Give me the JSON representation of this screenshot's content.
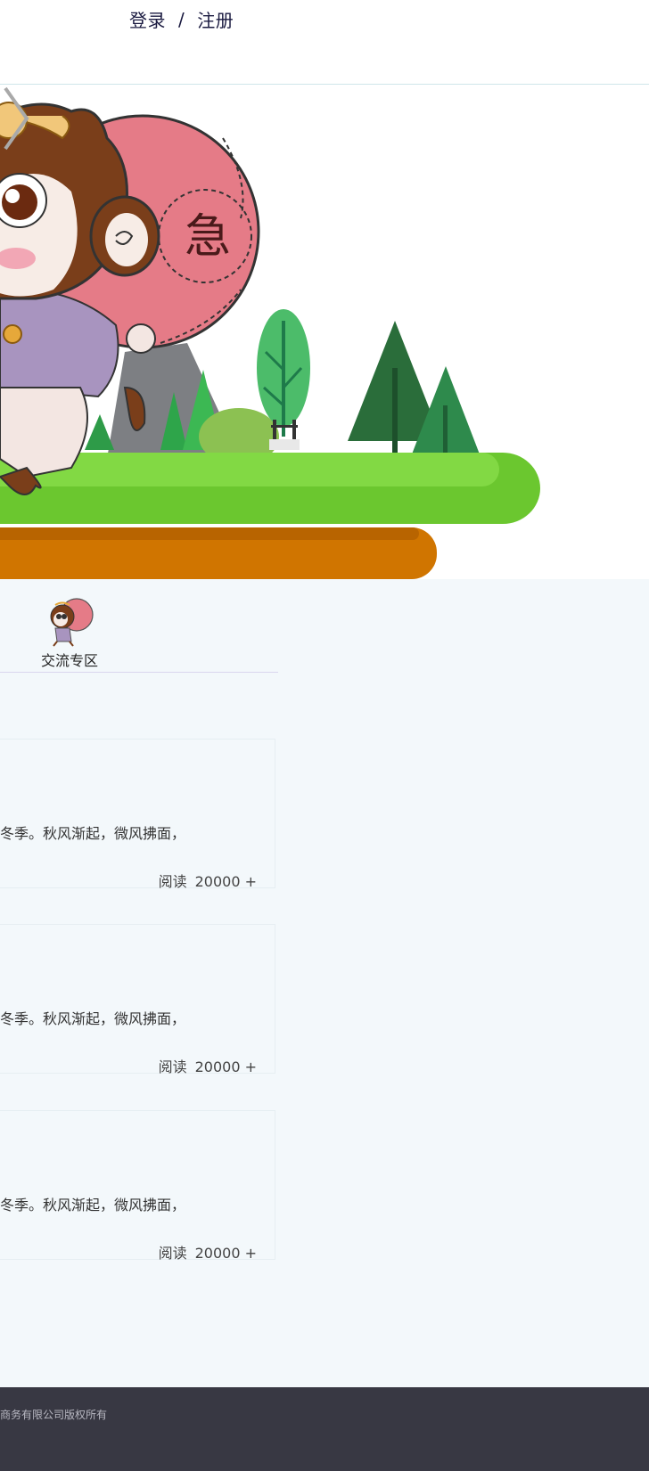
{
  "header": {
    "login": "登录",
    "separator": "/",
    "register": "注册"
  },
  "banner": {
    "slide_character": "monkey-king-cartoon",
    "next_icon": "chevron-right-icon",
    "colors": {
      "grass": "#6fcf3c",
      "soil": "#d07a10",
      "bag": "#e57b87",
      "trees": "#2e7d45"
    }
  },
  "categories": [
    {
      "label": "交流专区",
      "icon": "monkey-avatar-icon"
    }
  ],
  "posts": [
    {
      "excerpt": "冬季。秋风渐起，微风拂面，",
      "reads_label": "阅读",
      "reads_count": "20000 +"
    },
    {
      "excerpt": "冬季。秋风渐起，微风拂面，",
      "reads_label": "阅读",
      "reads_count": "20000 +"
    },
    {
      "excerpt": "冬季。秋风渐起，微风拂面，",
      "reads_label": "阅读",
      "reads_count": "20000 +"
    }
  ],
  "footer": {
    "copyright": "商务有限公司版权所有"
  }
}
